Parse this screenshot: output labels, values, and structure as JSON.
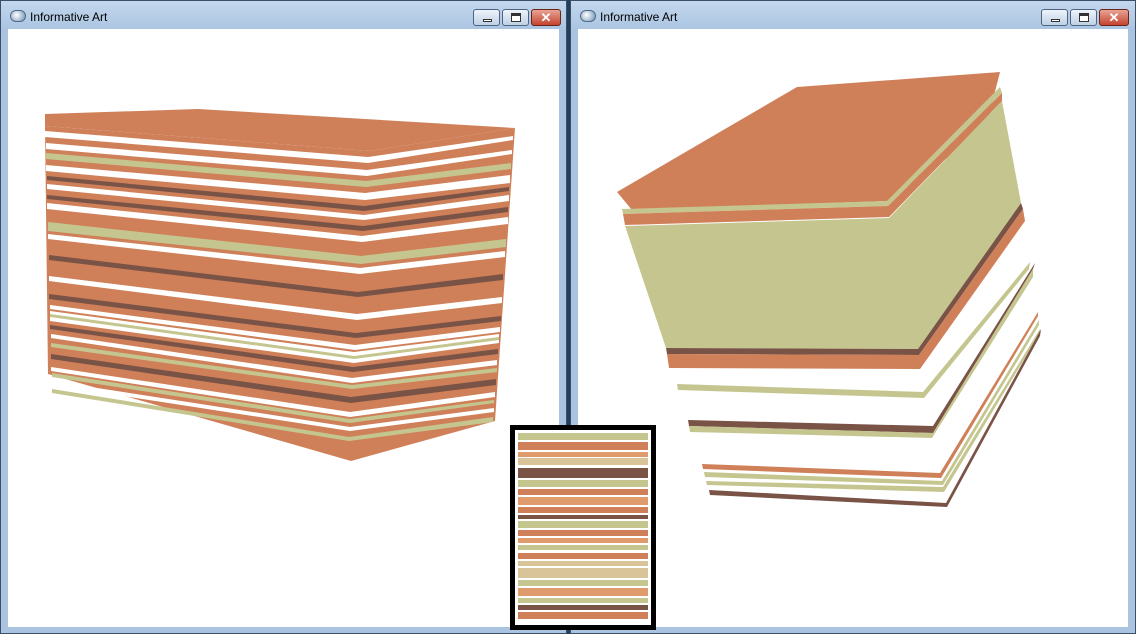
{
  "windows": [
    {
      "title": "Informative Art",
      "minimize_icon": "minimize-icon",
      "maximize_icon": "maximize-icon",
      "close_icon": "close-icon",
      "close_glyph": "✕"
    },
    {
      "title": "Informative Art",
      "minimize_icon": "minimize-icon",
      "maximize_icon": "maximize-icon",
      "close_icon": "close-icon",
      "close_glyph": "✕"
    }
  ],
  "palette": {
    "orange": "#cf8059",
    "sage": "#c5c68f",
    "brown": "#7a5347",
    "white": "#ffffff",
    "sand": "#d9c49a",
    "light_orange": "#e09b6c"
  }
}
